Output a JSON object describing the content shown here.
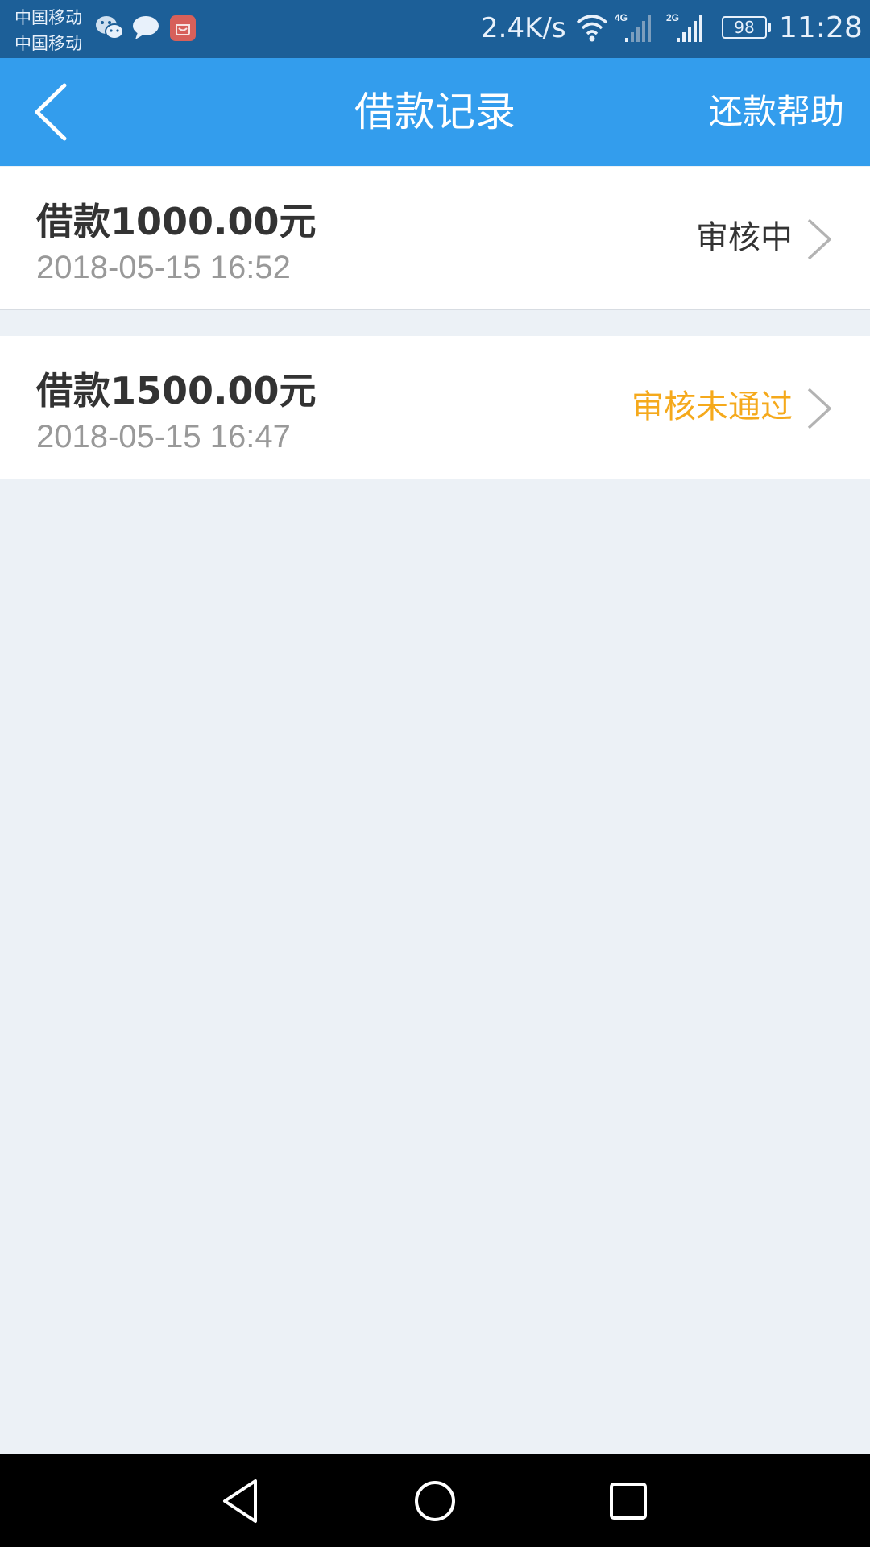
{
  "status_bar": {
    "carrier_1": "中国移动",
    "carrier_2": "中国移动",
    "net_speed": "2.4K/s",
    "net_4g": "4G",
    "net_2g": "2G",
    "battery": "98",
    "time": "11:28",
    "notification_icons": [
      "wechat-icon",
      "message-icon",
      "store-app-icon"
    ]
  },
  "header": {
    "title": "借款记录",
    "help_label": "还款帮助"
  },
  "loans": [
    {
      "amount": "借款1000.00元",
      "time": "2018-05-15 16:52",
      "status": "审核中",
      "status_color": "#333333"
    },
    {
      "amount": "借款1500.00元",
      "time": "2018-05-15 16:47",
      "status": "审核未通过",
      "status_color": "#f5a91b"
    }
  ],
  "colors": {
    "status_bar": "#1c5f98",
    "title_bar": "#339ded",
    "background": "#ecf1f6",
    "chevron": "#b3b3b3"
  }
}
